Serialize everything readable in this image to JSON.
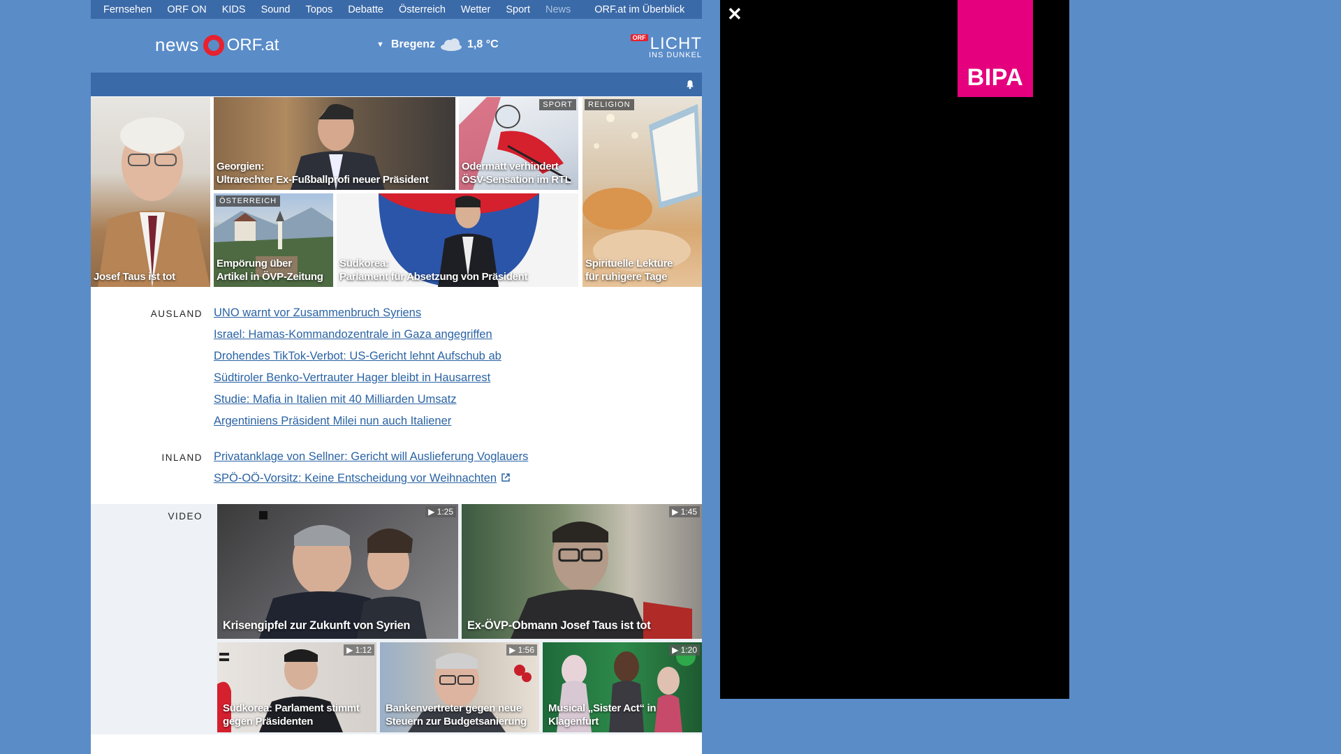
{
  "topnav": {
    "items": [
      "Fernsehen",
      "ORF ON",
      "KIDS",
      "Sound",
      "Topos",
      "Debatte",
      "Österreich",
      "Wetter",
      "Sport",
      "News"
    ],
    "active": "News",
    "overview": "ORF.at im Überblick"
  },
  "header": {
    "logo_news": "news",
    "logo_orf": "ORF.at",
    "weather_city": "Bregenz",
    "weather_temp": "1,8 °C",
    "weather_icon": "cloud-icon",
    "licht_badge": "ORF",
    "licht_big": "LICHT",
    "licht_small": "INS DUNKEL"
  },
  "top_stories": [
    {
      "caption": "Josef Taus ist tot",
      "tag": ""
    },
    {
      "caption": "Georgien: Ultrarechter Ex-Fußballprofi neuer Präsident",
      "line1": "Georgien:",
      "line2": "Ultrarechter Ex-Fußballprofi neuer Präsident",
      "tag": ""
    },
    {
      "caption": "Odermatt verhindert ÖSV-Sensation im RTL",
      "line1": "Odermatt verhindert",
      "line2": "ÖSV-Sensation im RTL",
      "tag": "SPORT"
    },
    {
      "caption": "Spirituelle Lektüre für ruhigere Tage",
      "line1": "Spirituelle Lektüre",
      "line2": "für ruhigere Tage",
      "tag": "RELIGION"
    },
    {
      "caption": "Empörung über Artikel in ÖVP-Zeitung",
      "line1": "Empörung über",
      "line2": "Artikel in ÖVP-Zeitung",
      "tag": "ÖSTERREICH"
    },
    {
      "caption": "Südkorea: Parlament für Absetzung von Präsident",
      "line1": "Südkorea:",
      "line2": "Parlament für Absetzung von Präsident",
      "tag": ""
    }
  ],
  "ausland": {
    "label": "AUSLAND",
    "links": [
      "UNO warnt vor Zusammenbruch Syriens",
      "Israel: Hamas-Kommandozentrale in Gaza angegriffen",
      "Drohendes TikTok-Verbot: US-Gericht lehnt Aufschub ab",
      "Südtiroler Benko-Vertrauter Hager bleibt in Hausarrest",
      "Studie: Mafia in Italien mit 40 Milliarden Umsatz",
      "Argentiniens Präsident Milei nun auch Italiener"
    ]
  },
  "inland": {
    "label": "INLAND",
    "links": [
      "Privatanklage von Sellner: Gericht will Auslieferung Voglauers",
      "SPÖ-OÖ-Vorsitz: Keine Entscheidung vor Weihnachten"
    ]
  },
  "video": {
    "label": "VIDEO",
    "items": [
      {
        "caption": "Krisengipfel zur Zukunft von Syrien",
        "duration": "1:25"
      },
      {
        "caption": "Ex-ÖVP-Obmann Josef Taus ist tot",
        "duration": "1:45"
      },
      {
        "line1": "Südkorea: Parlament stimmt",
        "line2": "gegen Präsidenten",
        "duration": "1:12"
      },
      {
        "line1": "Bankenvertreter gegen neue",
        "line2": "Steuern zur Budgetsanierung",
        "duration": "1:56"
      },
      {
        "line1": "Musical „Sister Act“ in",
        "line2": "Klagenfurt",
        "duration": "1:20"
      }
    ]
  },
  "ad": {
    "brand": "BIPA",
    "brand_color": "#e5007e"
  }
}
